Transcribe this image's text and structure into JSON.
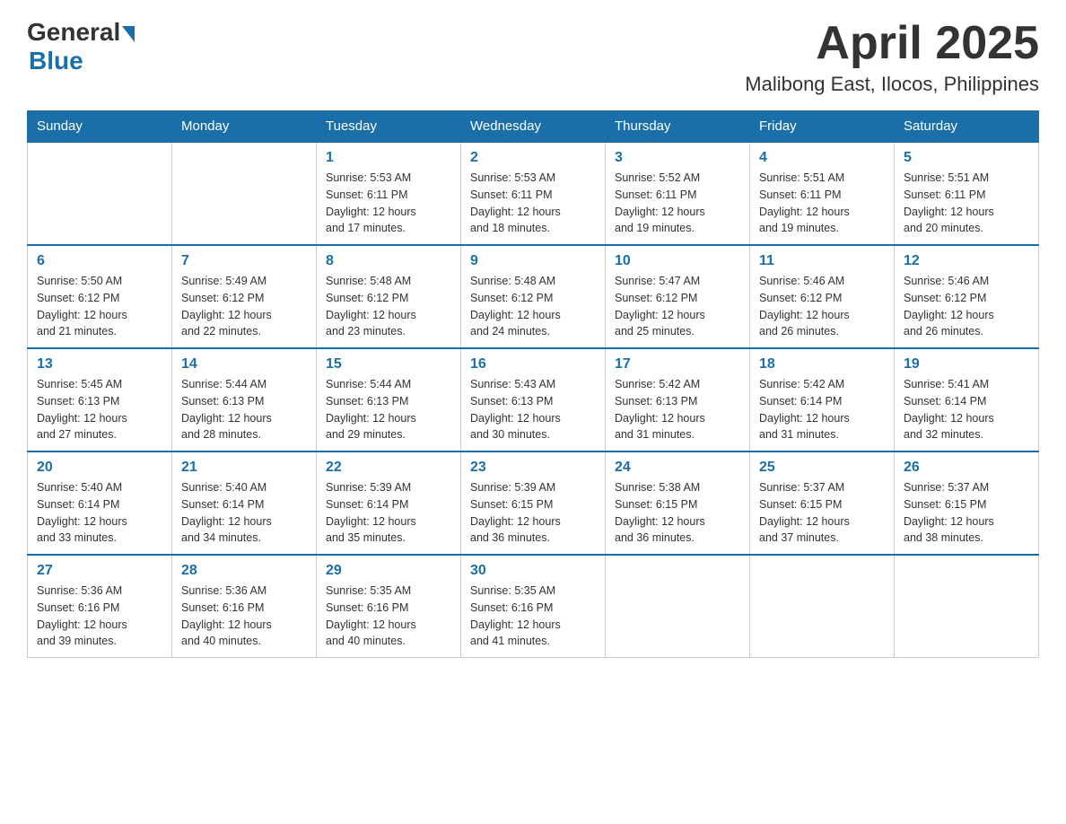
{
  "logo": {
    "general": "General",
    "blue": "Blue"
  },
  "header": {
    "month": "April 2025",
    "location": "Malibong East, Ilocos, Philippines"
  },
  "days_of_week": [
    "Sunday",
    "Monday",
    "Tuesday",
    "Wednesday",
    "Thursday",
    "Friday",
    "Saturday"
  ],
  "weeks": [
    [
      {
        "day": "",
        "info": ""
      },
      {
        "day": "",
        "info": ""
      },
      {
        "day": "1",
        "info": "Sunrise: 5:53 AM\nSunset: 6:11 PM\nDaylight: 12 hours\nand 17 minutes."
      },
      {
        "day": "2",
        "info": "Sunrise: 5:53 AM\nSunset: 6:11 PM\nDaylight: 12 hours\nand 18 minutes."
      },
      {
        "day": "3",
        "info": "Sunrise: 5:52 AM\nSunset: 6:11 PM\nDaylight: 12 hours\nand 19 minutes."
      },
      {
        "day": "4",
        "info": "Sunrise: 5:51 AM\nSunset: 6:11 PM\nDaylight: 12 hours\nand 19 minutes."
      },
      {
        "day": "5",
        "info": "Sunrise: 5:51 AM\nSunset: 6:11 PM\nDaylight: 12 hours\nand 20 minutes."
      }
    ],
    [
      {
        "day": "6",
        "info": "Sunrise: 5:50 AM\nSunset: 6:12 PM\nDaylight: 12 hours\nand 21 minutes."
      },
      {
        "day": "7",
        "info": "Sunrise: 5:49 AM\nSunset: 6:12 PM\nDaylight: 12 hours\nand 22 minutes."
      },
      {
        "day": "8",
        "info": "Sunrise: 5:48 AM\nSunset: 6:12 PM\nDaylight: 12 hours\nand 23 minutes."
      },
      {
        "day": "9",
        "info": "Sunrise: 5:48 AM\nSunset: 6:12 PM\nDaylight: 12 hours\nand 24 minutes."
      },
      {
        "day": "10",
        "info": "Sunrise: 5:47 AM\nSunset: 6:12 PM\nDaylight: 12 hours\nand 25 minutes."
      },
      {
        "day": "11",
        "info": "Sunrise: 5:46 AM\nSunset: 6:12 PM\nDaylight: 12 hours\nand 26 minutes."
      },
      {
        "day": "12",
        "info": "Sunrise: 5:46 AM\nSunset: 6:12 PM\nDaylight: 12 hours\nand 26 minutes."
      }
    ],
    [
      {
        "day": "13",
        "info": "Sunrise: 5:45 AM\nSunset: 6:13 PM\nDaylight: 12 hours\nand 27 minutes."
      },
      {
        "day": "14",
        "info": "Sunrise: 5:44 AM\nSunset: 6:13 PM\nDaylight: 12 hours\nand 28 minutes."
      },
      {
        "day": "15",
        "info": "Sunrise: 5:44 AM\nSunset: 6:13 PM\nDaylight: 12 hours\nand 29 minutes."
      },
      {
        "day": "16",
        "info": "Sunrise: 5:43 AM\nSunset: 6:13 PM\nDaylight: 12 hours\nand 30 minutes."
      },
      {
        "day": "17",
        "info": "Sunrise: 5:42 AM\nSunset: 6:13 PM\nDaylight: 12 hours\nand 31 minutes."
      },
      {
        "day": "18",
        "info": "Sunrise: 5:42 AM\nSunset: 6:14 PM\nDaylight: 12 hours\nand 31 minutes."
      },
      {
        "day": "19",
        "info": "Sunrise: 5:41 AM\nSunset: 6:14 PM\nDaylight: 12 hours\nand 32 minutes."
      }
    ],
    [
      {
        "day": "20",
        "info": "Sunrise: 5:40 AM\nSunset: 6:14 PM\nDaylight: 12 hours\nand 33 minutes."
      },
      {
        "day": "21",
        "info": "Sunrise: 5:40 AM\nSunset: 6:14 PM\nDaylight: 12 hours\nand 34 minutes."
      },
      {
        "day": "22",
        "info": "Sunrise: 5:39 AM\nSunset: 6:14 PM\nDaylight: 12 hours\nand 35 minutes."
      },
      {
        "day": "23",
        "info": "Sunrise: 5:39 AM\nSunset: 6:15 PM\nDaylight: 12 hours\nand 36 minutes."
      },
      {
        "day": "24",
        "info": "Sunrise: 5:38 AM\nSunset: 6:15 PM\nDaylight: 12 hours\nand 36 minutes."
      },
      {
        "day": "25",
        "info": "Sunrise: 5:37 AM\nSunset: 6:15 PM\nDaylight: 12 hours\nand 37 minutes."
      },
      {
        "day": "26",
        "info": "Sunrise: 5:37 AM\nSunset: 6:15 PM\nDaylight: 12 hours\nand 38 minutes."
      }
    ],
    [
      {
        "day": "27",
        "info": "Sunrise: 5:36 AM\nSunset: 6:16 PM\nDaylight: 12 hours\nand 39 minutes."
      },
      {
        "day": "28",
        "info": "Sunrise: 5:36 AM\nSunset: 6:16 PM\nDaylight: 12 hours\nand 40 minutes."
      },
      {
        "day": "29",
        "info": "Sunrise: 5:35 AM\nSunset: 6:16 PM\nDaylight: 12 hours\nand 40 minutes."
      },
      {
        "day": "30",
        "info": "Sunrise: 5:35 AM\nSunset: 6:16 PM\nDaylight: 12 hours\nand 41 minutes."
      },
      {
        "day": "",
        "info": ""
      },
      {
        "day": "",
        "info": ""
      },
      {
        "day": "",
        "info": ""
      }
    ]
  ]
}
